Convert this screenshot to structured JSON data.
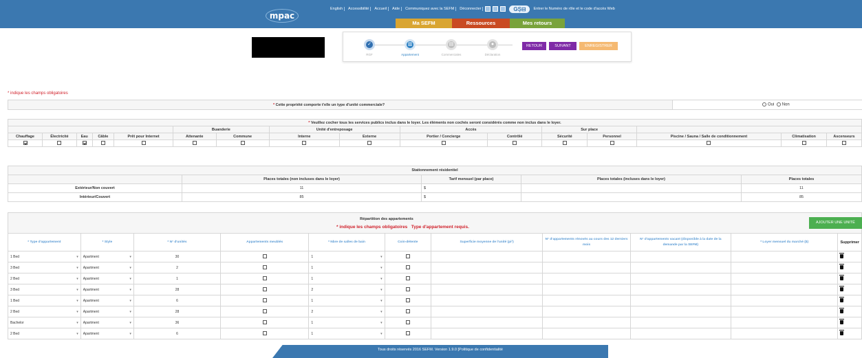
{
  "header": {
    "logo": "mpac",
    "links": [
      "English",
      "Accessibilité",
      "Accueil",
      "Aide",
      "Communiquez avec la SEFM",
      "Déconnecter"
    ],
    "sro_badge": "ǤŞ⊟",
    "roll_prompt": "Entrer le Numéro de rôle et le code d'accès Web",
    "tabs": [
      "Ma SEFM",
      "Ressources",
      "Mes retours"
    ],
    "brand_colors": {
      "bar": "#3b78b0",
      "tab1": "#d9a531",
      "tab2": "#c94a22",
      "tab3": "#79a33b"
    }
  },
  "wizard": {
    "steps": [
      {
        "label": "RGF",
        "state": "done",
        "icon": "check-icon"
      },
      {
        "label": "Appartement",
        "state": "active",
        "icon": "building-icon"
      },
      {
        "label": "Commerciales",
        "state": "pending",
        "icon": "store-icon"
      },
      {
        "label": "Déclaration",
        "state": "pending",
        "icon": "document-icon"
      }
    ],
    "buttons": {
      "retour": "RETOUR",
      "suivant": "SUIVANT",
      "enregistrer": "ENREGISTRER"
    }
  },
  "required_note": "* indique les champs obligatoires",
  "commercial_question": {
    "asterisk": "*",
    "text": "Cette propriété comporte t'elle un type d'unité commerciale?",
    "options": [
      "Oui",
      "Non"
    ]
  },
  "utilities": {
    "caption_asterisk": "*",
    "caption": "Veuillez cocher tous les services publics inclus dans le loyer. Les éléments non cochés seront considérés comme non inclus dans le loyer.",
    "groups": {
      "laundry": "Buanderie",
      "storage": "Unité d'entreposage",
      "access": "Accès",
      "onsite": "Sur place"
    },
    "columns": [
      "Chauffage",
      "Électricité",
      "Eau",
      "Câble",
      "Prêt pour Internet",
      "Attenante",
      "Commune",
      "Interne",
      "Externe",
      "Portier / Concierge",
      "Contrôlé",
      "Sécurité",
      "Personnel",
      "Piscine / Sauna / Salle de conditionnement",
      "Climatisation",
      "Ascenseurs"
    ],
    "checked": [
      true,
      false,
      true,
      false,
      false,
      false,
      false,
      false,
      false,
      false,
      false,
      false,
      false,
      false,
      false,
      false
    ]
  },
  "parking": {
    "title": "Stationnement résidentiel",
    "headers": [
      "Places totales (non incluses dans le loyer)",
      "Tarif mensuel (par place)",
      "Places totales (incluses dans le loyer)",
      "Places totales"
    ],
    "rows": [
      {
        "label": "Extérieur/Non couvert",
        "not_included": "11",
        "monthly": "$",
        "included": "",
        "total": "11"
      },
      {
        "label": "Intérieur/Couvert",
        "not_included": "85",
        "monthly": "$",
        "included": "",
        "total": "85"
      }
    ]
  },
  "apartments": {
    "title": "Répartition des appartements",
    "msg_required": "* indique les champs obligatoires",
    "msg_type": "Type d'appartement requis.",
    "add_button": "AJOUTER UNE UNITÉ",
    "headers": {
      "type": "* Type d'appartement",
      "style": "* Style",
      "units": "* N° d'unités",
      "furnished": "Appartements meublés",
      "baths": "* Nbre de salles de bain",
      "den": "Coin-détente",
      "area": "Superficie moyenne de l'unité (pi²)",
      "renovated": "N° d'appartements rénovés au cours des 12 derniers mois",
      "vacant": "N° d'appartements vacant (disponible à la date de la demande par la SEFM)",
      "rent": "* Loyer mensuel du marché ($)",
      "delete": "Supprimer"
    },
    "rows": [
      {
        "type": "1 Bed",
        "style": "Apartment",
        "units": "30",
        "baths": "1"
      },
      {
        "type": "3 Bed",
        "style": "Apartment",
        "units": "2",
        "baths": "1"
      },
      {
        "type": "2 Bed",
        "style": "Apartment",
        "units": "1",
        "baths": "1"
      },
      {
        "type": "3 Bed",
        "style": "Apartment",
        "units": "28",
        "baths": "2"
      },
      {
        "type": "1 Bed",
        "style": "Apartment",
        "units": "6",
        "baths": "1"
      },
      {
        "type": "2 Bed",
        "style": "Apartment",
        "units": "28",
        "baths": "2"
      },
      {
        "type": "Bachelor",
        "style": "Apartment",
        "units": "36",
        "baths": "1"
      },
      {
        "type": "2 Bed",
        "style": "Apartment",
        "units": "6",
        "baths": "1"
      }
    ]
  },
  "footer": "Tous droits réservés 2016 SEFM. Version 1.9.0 [Politique de confidentialité"
}
